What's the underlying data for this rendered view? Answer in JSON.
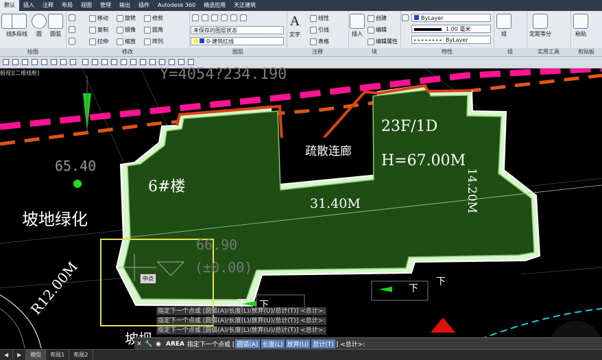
{
  "tabs": [
    "默认",
    "插入",
    "注释",
    "布局",
    "视图",
    "管理",
    "输出",
    "插件",
    "Autodesk 360",
    "精选应用",
    "天正建筑"
  ],
  "ribbon": {
    "draw": {
      "title": "绘图",
      "line": "线",
      "polyline": "多段线",
      "circle": "圆",
      "arc": "圆弧"
    },
    "modify": {
      "title": "修改",
      "move": "移动",
      "rotate": "旋转",
      "trim": "修剪",
      "copy": "复制",
      "mirror": "镜像",
      "fillet": "圆角",
      "stretch": "拉伸",
      "scale": "缩放",
      "array": "阵列"
    },
    "layers": {
      "title": "图层",
      "state": "未保存的图层状态",
      "current": "0-建筑红线"
    },
    "annotation": {
      "title": "注释",
      "text": "文字",
      "linear": "线性",
      "leader": "引线",
      "table": "表格"
    },
    "block": {
      "title": "块",
      "insert": "插入",
      "create": "创建",
      "edit": "编辑",
      "edit_attr": "编辑属性"
    },
    "properties": {
      "title": "特性",
      "color": "ByLayer",
      "lineweight": "1.00 毫米",
      "linetype": "ByLayer"
    },
    "groups": {
      "title": "组",
      "group": "组"
    },
    "utilities": {
      "title": "实用工具",
      "measure": "定距等分"
    },
    "clipboard": {
      "title": "剪贴板",
      "paste": "粘贴"
    }
  },
  "viewport_label": "俯视][二维线框]",
  "drawing": {
    "coord": "Y=4054?234.190",
    "green_label": "65.40",
    "slope_green": "坡地绿化",
    "building": "6#楼",
    "corridor": "疏散连廊",
    "floors": "23F/1D",
    "height": "H=67.00M",
    "length": "31.40M",
    "width": "14.20M",
    "elev": "66.90",
    "elev_rel": "(±0.00)",
    "radius": "R12.00M",
    "down1": "下",
    "down2": "下",
    "down3": "下",
    "down4": "下",
    "slope_bottom": "坡坝",
    "tooltip": "中点"
  },
  "command": {
    "history": [
      "指定下一个点或 [圆弧(A)/长度(L)/放弃(U)/总计(T)] <总计>:",
      "指定下一个点或 [圆弧(A)/长度(L)/放弃(U)/总计(T)] <总计>:",
      "指定下一个点或 [圆弧(A)/长度(L)/放弃(U)/总计(T)] <总计>:"
    ],
    "prompt_cmd": "AREA",
    "prompt_text": "指定下一个点或 [",
    "opt_arc": "圆弧(A)",
    "opt_len": "长度(L)",
    "opt_undo": "放弃(U)",
    "opt_total": "总计(T)",
    "prompt_end": "] <总计>:"
  },
  "layout_tabs": [
    "模型",
    "布局1",
    "布局2"
  ],
  "colors": {
    "building_fill": "#1f4d14",
    "boundary_red": "#d9430f",
    "road_magenta": "#ff1493",
    "accent_green": "#22cc22"
  }
}
